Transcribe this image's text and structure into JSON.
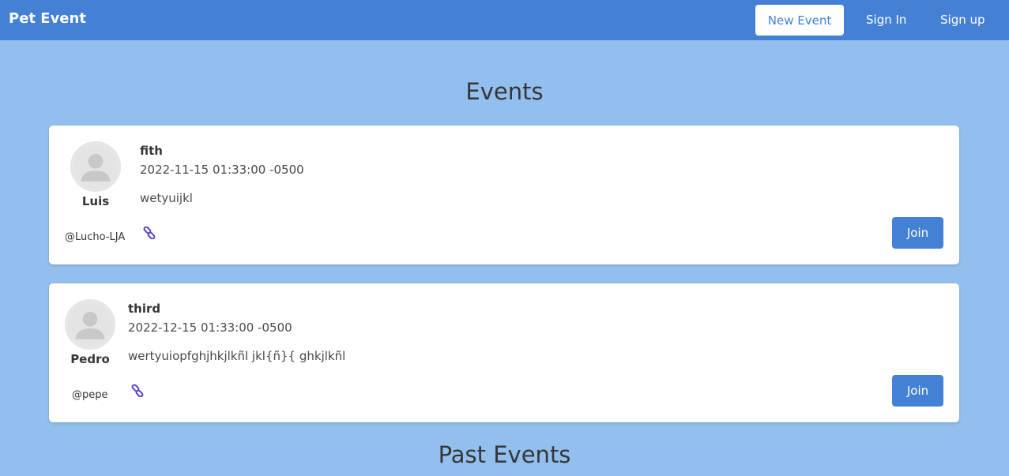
{
  "navbar": {
    "brand": "Pet Event",
    "new_event": "New Event",
    "sign_in": "Sign In",
    "sign_up": "Sign up"
  },
  "sections": {
    "events_title": "Events",
    "past_events_title": "Past Events"
  },
  "events": [
    {
      "author": "Luis",
      "handle": "@Lucho-LJA",
      "title": "fith",
      "date": "2022-11-15 01:33:00 -0500",
      "description": "wetyuijkl",
      "join_label": "Join",
      "link_icon": "link-icon"
    },
    {
      "author": "Pedro",
      "handle": "@pepe",
      "title": "third",
      "date": "2022-12-15 01:33:00 -0500",
      "description": "wertyuiopfghjhkjlkñl jkl{ñ}{ ghkjlkñl",
      "join_label": "Join",
      "link_icon": "link-icon"
    }
  ],
  "colors": {
    "navbar": "#4481d5",
    "background": "#93bfee",
    "accent": "#4481d5",
    "link_icon": "#5b3fc4"
  }
}
